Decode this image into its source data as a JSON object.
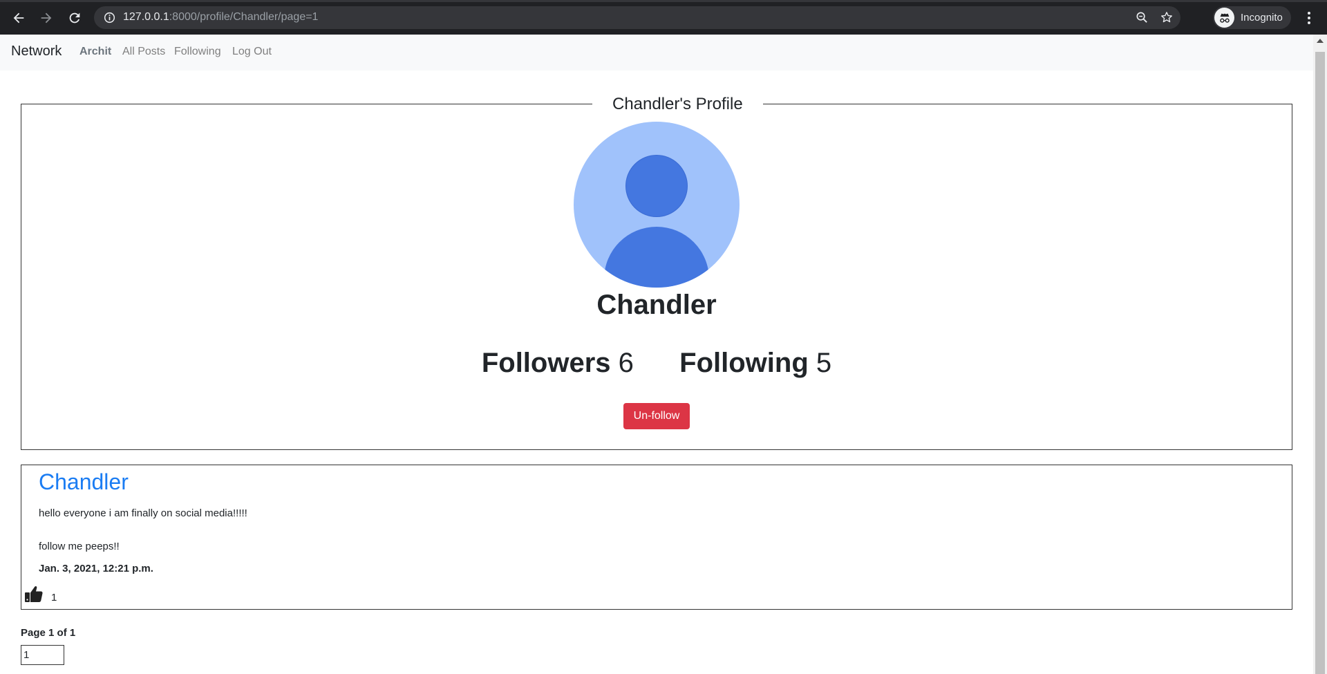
{
  "browser": {
    "url_host": "127.0.0.1",
    "url_path": ":8000/profile/Chandler/page=1",
    "profile_label": "Incognito"
  },
  "navbar": {
    "brand": "Network",
    "user": "Archit",
    "links": [
      "All Posts",
      "Following",
      "Log Out"
    ]
  },
  "profile": {
    "legend": "Chandler's Profile",
    "name": "Chandler",
    "followers_label": "Followers",
    "followers_count": "6",
    "following_label": "Following",
    "following_count": "5",
    "action_button": "Un-follow",
    "button_color": "#dc3545"
  },
  "posts": [
    {
      "author": "Chandler",
      "lines": [
        "hello everyone i am finally on social media!!!!!",
        "follow me peeps!!"
      ],
      "timestamp": "Jan. 3, 2021, 12:21 p.m.",
      "likes": "1",
      "like_icon": "thumbs-up-icon"
    }
  ],
  "pagination": {
    "label": "Page 1 of 1",
    "input_value": "1"
  },
  "colors": {
    "link": "#1a7cf3",
    "avatar_bg": "#a0c2fb",
    "avatar_fg": "#4477e0"
  }
}
